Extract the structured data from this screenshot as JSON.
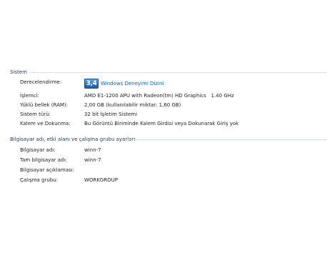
{
  "system": {
    "header": "Sistem",
    "rows": [
      {
        "label": "Derecelendirme:",
        "score": "3,4",
        "link": "Windows Deneyimi Dizini"
      },
      {
        "label": "İşlemci:",
        "value": "AMD E1-1200 APU with Radeon(tm) HD Graphics   1.40 GHz"
      },
      {
        "label": "Yüklü bellek (RAM):",
        "value": "2,00 GB (kullanılabilir miktar: 1,60 GB)"
      },
      {
        "label": "Sistem türü:",
        "value": "32 bit İşletim Sistemi"
      },
      {
        "label": "Kalem ve Dokunma:",
        "value": "Bu Görüntü Biriminde Kalem Girdisi veya Dokunarak Giriş yok"
      }
    ]
  },
  "network": {
    "header": "Bilgisayar adı, etki alanı ve çalışma grubu ayarları",
    "rows": [
      {
        "label": "Bilgisayar adı:",
        "value": "winn-7"
      },
      {
        "label": "Tam bilgisayar adı:",
        "value": "winn-7"
      },
      {
        "label": "Bilgisayar açıklaması:",
        "value": ""
      },
      {
        "label": "Çalışma grubu:",
        "value": "WORKGROUP"
      }
    ]
  }
}
